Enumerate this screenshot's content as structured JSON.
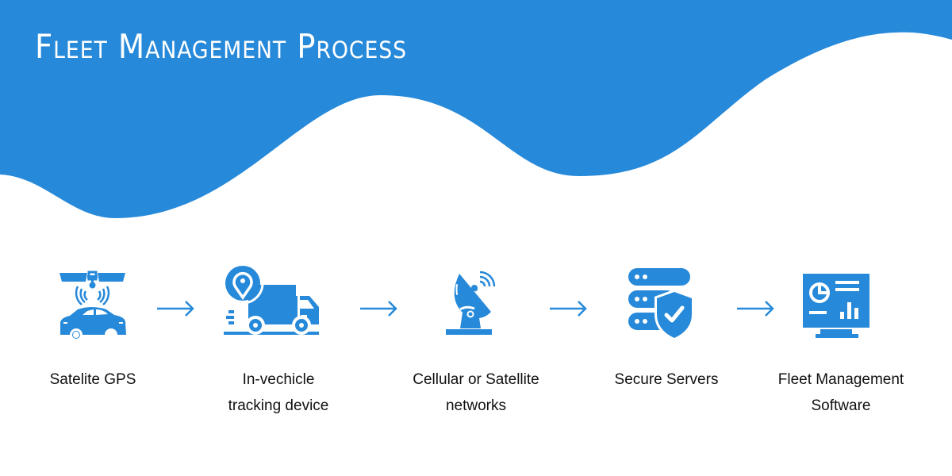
{
  "title": "Fleet Management Process",
  "colors": {
    "accent": "#2789d9",
    "background": "#ffffff",
    "text": "#111111"
  },
  "steps": [
    {
      "icon": "satellite-car-gps-icon",
      "label_lines": [
        "Satelite GPS"
      ]
    },
    {
      "icon": "truck-location-pin-icon",
      "label_lines": [
        "In-vechicle",
        "tracking device"
      ]
    },
    {
      "icon": "satellite-dish-icon",
      "label_lines": [
        "Cellular or Satellite",
        "networks"
      ]
    },
    {
      "icon": "server-shield-icon",
      "label_lines": [
        "Secure Servers"
      ]
    },
    {
      "icon": "monitor-dashboard-icon",
      "label_lines": [
        "Fleet Management",
        "Software"
      ]
    }
  ],
  "connectors": [
    {
      "icon": "arrow-right-icon",
      "from": "Satelite GPS",
      "to": "In-vechicle tracking device"
    },
    {
      "icon": "arrow-right-icon",
      "from": "In-vechicle tracking device",
      "to": "Cellular or Satellite networks"
    },
    {
      "icon": "arrow-right-icon",
      "from": "Cellular or Satellite networks",
      "to": "Secure Servers"
    },
    {
      "icon": "arrow-right-icon",
      "from": "Secure Servers",
      "to": "Fleet Management Software"
    }
  ]
}
